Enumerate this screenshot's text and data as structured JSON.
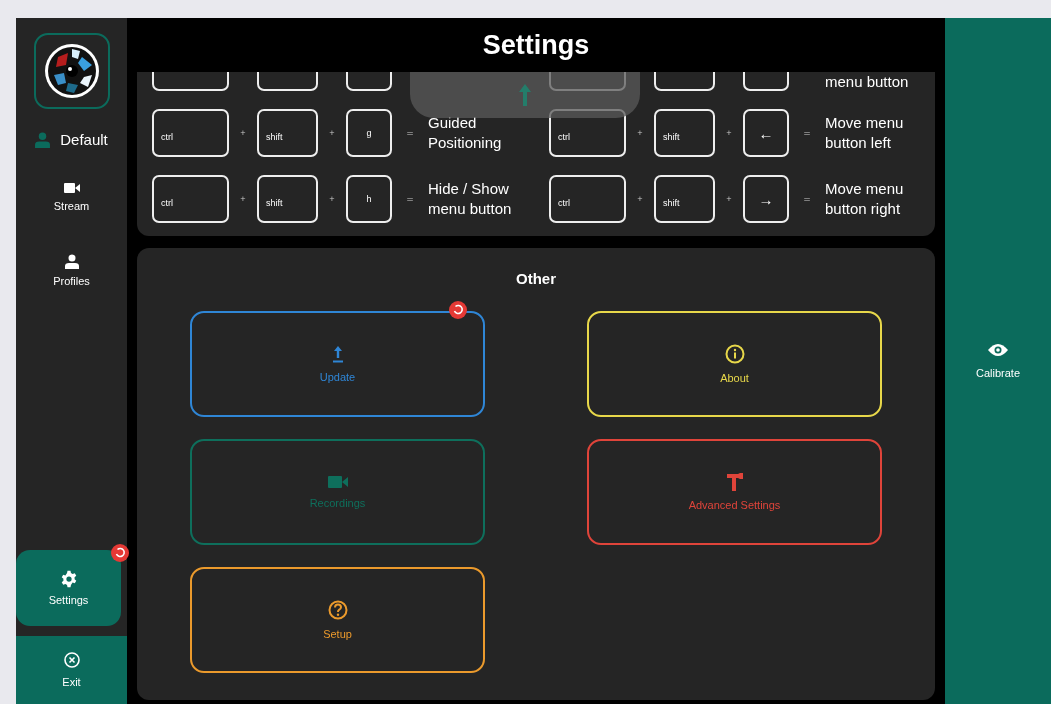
{
  "window": {
    "title": "Settings"
  },
  "sidebar": {
    "profile": {
      "label": "Default"
    },
    "items": [
      {
        "label": "Stream",
        "selected": false,
        "badge": false
      },
      {
        "label": "Profiles",
        "selected": false,
        "badge": false
      },
      {
        "label": "Settings",
        "selected": true,
        "badge": true
      }
    ],
    "exit": {
      "label": "Exit"
    }
  },
  "shortcuts": [
    {
      "keys": [
        {
          "kind": "blank"
        },
        {
          "kind": "blank"
        },
        {
          "kind": "blank"
        }
      ]
    },
    {
      "keys": [
        {
          "kind": "blank"
        },
        {
          "kind": "blank"
        },
        {
          "kind": "blank"
        }
      ],
      "description": "menu button"
    },
    {
      "keys": [
        {
          "kind": "text",
          "label": "ctrl"
        },
        {
          "kind": "text",
          "label": "shift"
        },
        {
          "kind": "text",
          "label": "g"
        }
      ],
      "separators": [
        "+",
        "+"
      ],
      "equals": "=",
      "description": "Guided Positioning"
    },
    {
      "keys": [
        {
          "kind": "text",
          "label": "ctrl"
        },
        {
          "kind": "text",
          "label": "shift"
        },
        {
          "kind": "symbol",
          "label": "←"
        }
      ],
      "separators": [
        "+",
        "+"
      ],
      "equals": "=",
      "description": "Move menu button left"
    },
    {
      "keys": [
        {
          "kind": "text",
          "label": "ctrl"
        },
        {
          "kind": "text",
          "label": "shift"
        },
        {
          "kind": "text",
          "label": "h"
        }
      ],
      "separators": [
        "+",
        "+"
      ],
      "equals": "=",
      "description": "Hide / Show menu button"
    },
    {
      "keys": [
        {
          "kind": "text",
          "label": "ctrl"
        },
        {
          "kind": "text",
          "label": "shift"
        },
        {
          "kind": "symbol",
          "label": "→"
        }
      ],
      "separators": [
        "+",
        "+"
      ],
      "equals": "=",
      "description": "Move menu button right"
    }
  ],
  "other": {
    "title": "Other",
    "cards": [
      {
        "label": "Update",
        "color": "#2f86d6",
        "badge": true
      },
      {
        "label": "About",
        "color": "#e8d84a",
        "badge": false
      },
      {
        "label": "Recordings",
        "color": "#0e6f5c",
        "badge": false
      },
      {
        "label": "Advanced Settings",
        "color": "#e0443a",
        "badge": false
      },
      {
        "label": "Setup",
        "color": "#eb9a2c",
        "badge": false
      }
    ]
  },
  "right_panel": {
    "label": "Calibrate"
  }
}
